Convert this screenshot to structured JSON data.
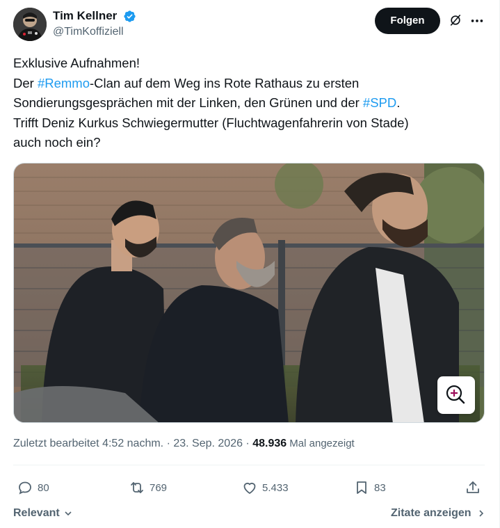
{
  "author": {
    "name": "Tim Kellner",
    "handle": "@TimKoffiziell",
    "verified": true
  },
  "header": {
    "follow_label": "Folgen"
  },
  "tweet": {
    "line1": "Exklusive Aufnahmen!",
    "line2_pre": "Der ",
    "line2_tag": "#Remmo",
    "line2_post": "-Clan auf dem Weg ins Rote Rathaus zu ersten",
    "line3_pre": "Sondierungsgesprächen mit der Linken, den Grünen und der ",
    "line3_tag": "#SPD",
    "line3_post": ".",
    "line4": "Trifft Deniz Kurkus Schwiegermutter (Fluchtwagenfahrerin von Stade)",
    "line5": "auch noch ein?"
  },
  "meta": {
    "edited": "Zuletzt bearbeitet 4:52 nachm. · 23. Sep. 2026 · ",
    "views_count": "48.936",
    "views_label": " Mal angezeigt"
  },
  "actions": {
    "replies": "80",
    "reposts": "769",
    "likes": "5.433",
    "bookmarks": "83"
  },
  "footer": {
    "sort_label": "Relevant",
    "quotes_label": "Zitate anzeigen"
  },
  "colors": {
    "link": "#1d9bf0",
    "text": "#0f1419",
    "secondary": "#536471",
    "verified": "#1d9bf0"
  },
  "icons": [
    "verified-badge-icon",
    "grok-icon",
    "more-icon",
    "zoom-icon",
    "reply-icon",
    "repost-icon",
    "like-icon",
    "bookmark-icon",
    "share-icon",
    "chevron-down-icon",
    "chevron-right-icon"
  ]
}
